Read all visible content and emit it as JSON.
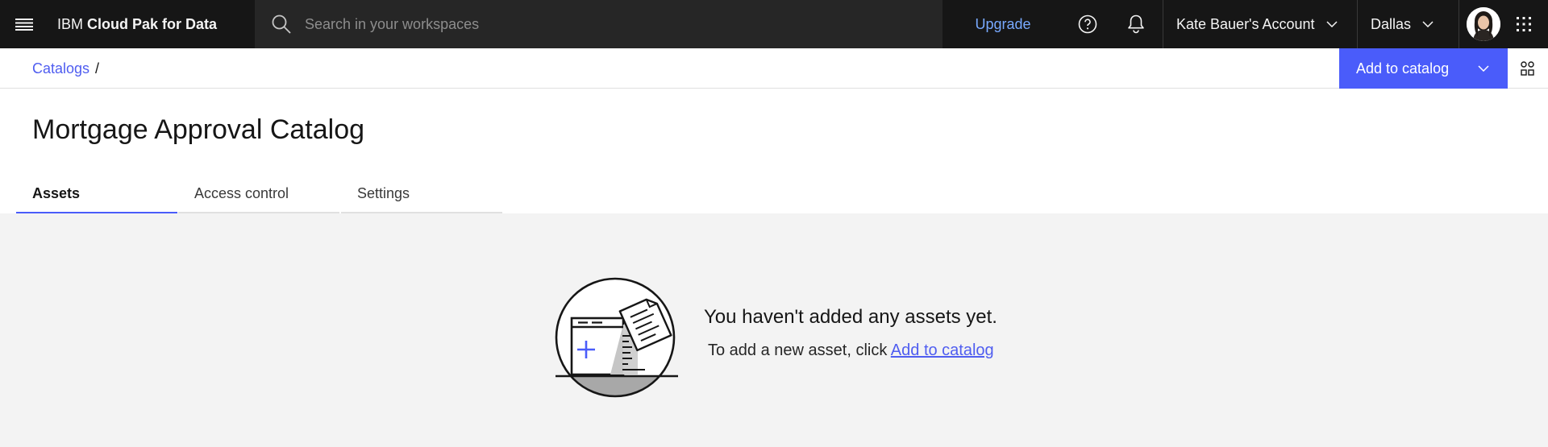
{
  "header": {
    "brand_prefix": "IBM",
    "brand_product": "Cloud Pak for Data",
    "search_placeholder": "Search in your workspaces",
    "upgrade_label": "Upgrade",
    "account_label": "Kate Bauer's Account",
    "region_label": "Dallas",
    "icons": [
      "menu-icon",
      "search-icon",
      "help-icon",
      "notification-icon",
      "chevron-down-icon",
      "avatar",
      "app-switcher-icon"
    ]
  },
  "breadcrumb": {
    "items": [
      {
        "label": "Catalogs"
      }
    ],
    "separator": "/"
  },
  "toolbar": {
    "add_label": "Add to catalog",
    "colors": {
      "primary": "#4a5cfa",
      "link": "#4f5df0"
    }
  },
  "page": {
    "title": "Mortgage Approval Catalog",
    "tabs": [
      {
        "label": "Assets",
        "active": true
      },
      {
        "label": "Access control",
        "active": false
      },
      {
        "label": "Settings",
        "active": false
      }
    ]
  },
  "empty_state": {
    "title": "You haven't added any assets yet.",
    "description_prefix": "To add a new asset, click ",
    "link_label": "Add to catalog"
  }
}
